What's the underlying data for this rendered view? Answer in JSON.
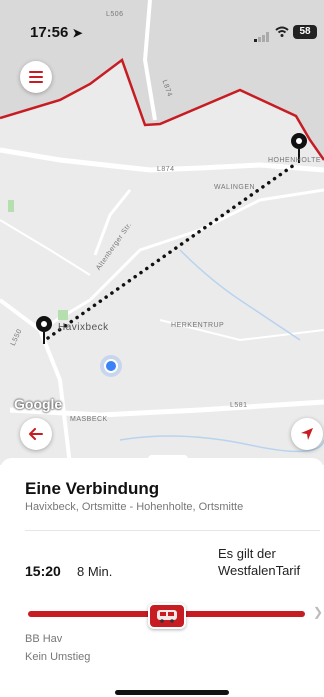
{
  "status_bar": {
    "time": "17:56",
    "battery": "58"
  },
  "map": {
    "labels": {
      "l506": "L506",
      "l874_top": "L874",
      "l874": "L874",
      "hohenholte": "HOHENHOLTE",
      "walingen": "WALINGEN",
      "altenberger": "Altenberger Str.",
      "havixbeck": "Havixbeck",
      "herkentrup": "HERKENTRUP",
      "l550": "L550",
      "masbeck": "MASBECK",
      "l581": "L581",
      "google": "Google"
    },
    "icons": {
      "menu": "menu-icon",
      "back": "arrow-left-icon",
      "locate": "navigation-arrow-icon"
    },
    "colors": {
      "route_boundary": "#c71c22",
      "accent": "#c71c22"
    }
  },
  "sheet": {
    "title": "Eine Verbindung",
    "subtitle": "Havixbeck, Ortsmitte - Hohenholte, Ortsmitte",
    "connection": {
      "departure": "15:20",
      "duration": "8 Min.",
      "tariff": "Es gilt der WestfalenTarif",
      "line": "BB Hav",
      "changes": "Kein Umstieg"
    }
  }
}
